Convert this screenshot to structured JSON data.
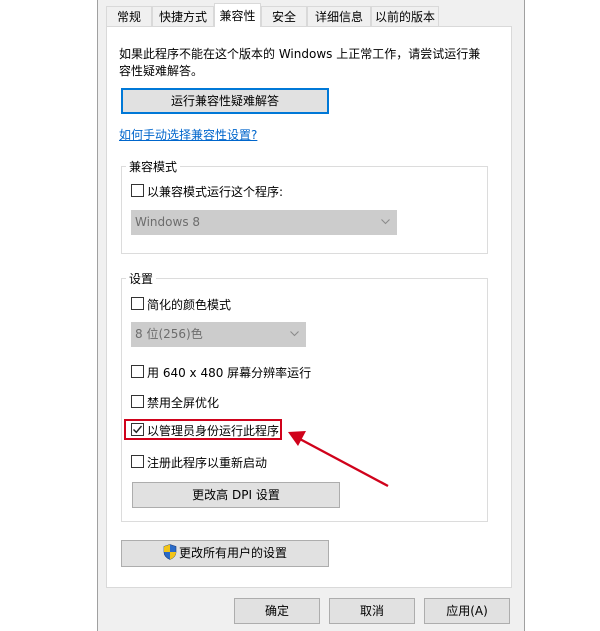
{
  "tabs": [
    "常规",
    "快捷方式",
    "兼容性",
    "安全",
    "详细信息",
    "以前的版本"
  ],
  "active_tab_index": 2,
  "intro_text_line1": "如果此程序不能在这个版本的 Windows 上正常工作，请尝试运行兼",
  "intro_text_line2": "容性疑难解答。",
  "troubleshooter_button": "运行兼容性疑难解答",
  "manual_link": "如何手动选择兼容性设置?",
  "compat_mode": {
    "legend": "兼容模式",
    "checkbox_label": "以兼容模式运行这个程序:",
    "checked": false,
    "select_value": "Windows 8"
  },
  "settings": {
    "legend": "设置",
    "reduced_color": {
      "label": "简化的颜色模式",
      "checked": false
    },
    "color_select_value": "8 位(256)色",
    "res_640": {
      "label": "用 640 x 480 屏幕分辨率运行",
      "checked": false
    },
    "disable_fullscreen": {
      "label": "禁用全屏优化",
      "checked": false
    },
    "run_as_admin": {
      "label": "以管理员身份运行此程序",
      "checked": true
    },
    "register_restart": {
      "label": "注册此程序以重新启动",
      "checked": false
    },
    "dpi_button": "更改高 DPI 设置"
  },
  "all_users_button": "更改所有用户的设置",
  "footer": {
    "ok": "确定",
    "cancel": "取消",
    "apply": "应用(A)"
  },
  "colors": {
    "highlight": "#d0021b",
    "link": "#0066cc",
    "focus": "#0078d7"
  },
  "icons": {
    "shield": "uac-shield-icon",
    "annotation_arrow": "red-arrow-icon"
  }
}
